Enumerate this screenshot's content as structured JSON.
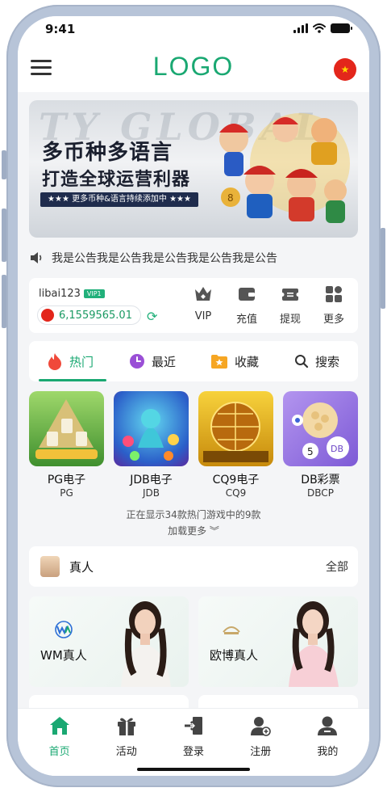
{
  "status_bar": {
    "time": "9:41"
  },
  "header": {
    "logo": "LOGO",
    "language_flag_icon": "china-flag-icon"
  },
  "banner": {
    "bg_text": "TY GLOBAL",
    "title_line1": "多币种多语言",
    "title_line2": "打造全球运营利器",
    "ribbon": "★★★ 更多币种&语言持续添加中 ★★★"
  },
  "notice": {
    "text": "我是公告我是公告我是公告我是公告我是公告"
  },
  "user": {
    "username": "libai123",
    "vip_badge": "VIP1",
    "balance": "6,1559565.01"
  },
  "actions": [
    {
      "label": "VIP",
      "icon": "crown-icon"
    },
    {
      "label": "充值",
      "icon": "wallet-icon"
    },
    {
      "label": "提现",
      "icon": "ticket-icon"
    },
    {
      "label": "更多",
      "icon": "grid-icon"
    }
  ],
  "tabs": [
    {
      "label": "热门",
      "icon": "flame-icon",
      "active": true
    },
    {
      "label": "最近",
      "icon": "clock-icon"
    },
    {
      "label": "收藏",
      "icon": "star-folder-icon"
    },
    {
      "label": "搜索",
      "icon": "search-icon"
    }
  ],
  "games": [
    {
      "name": "PG电子",
      "code": "PG"
    },
    {
      "name": "JDB电子",
      "code": "JDB"
    },
    {
      "name": "CQ9电子",
      "code": "CQ9"
    },
    {
      "name": "DB彩票",
      "code": "DBCP"
    }
  ],
  "showing_text": "正在显示34款热门游戏中的9款",
  "load_more": "加载更多 ︾",
  "live": {
    "title": "真人",
    "all_label": "全部",
    "cards": [
      {
        "brand": "WM真人"
      },
      {
        "brand": "欧博真人"
      }
    ]
  },
  "bottom_nav": [
    {
      "label": "首页",
      "icon": "home-icon",
      "active": true
    },
    {
      "label": "活动",
      "icon": "gift-icon"
    },
    {
      "label": "登录",
      "icon": "login-icon"
    },
    {
      "label": "注册",
      "icon": "user-add-icon"
    },
    {
      "label": "我的",
      "icon": "user-icon"
    }
  ],
  "colors": {
    "accent": "#1aa872",
    "frame": "#b7c4d8",
    "background": "#f4f5f7"
  }
}
